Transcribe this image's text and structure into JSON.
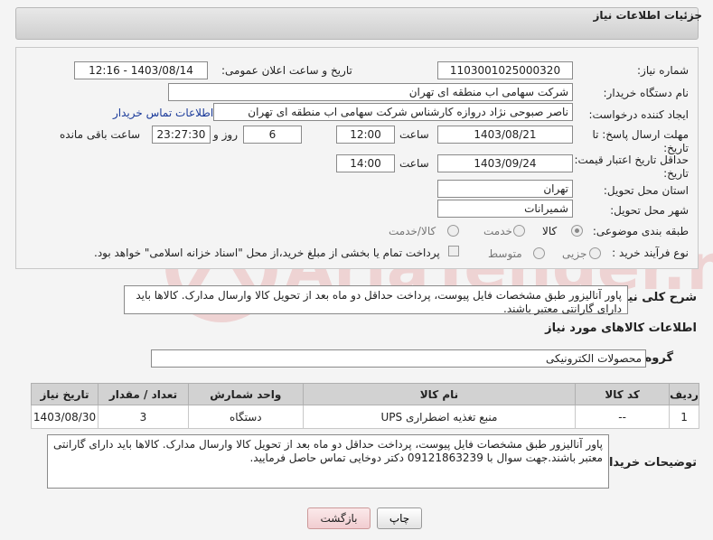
{
  "panel": {
    "title": "جزئیات اطلاعات نیاز"
  },
  "form": {
    "need_number_label": "شماره نیاز:",
    "need_number": "1103001025000320",
    "announce_label": "تاریخ و ساعت اعلان عمومی:",
    "announce_value": "1403/08/14 - 12:16",
    "buyer_org_label": "نام دستگاه خریدار:",
    "buyer_org": "شرکت سهامی اب منطقه ای تهران",
    "creator_label": "ایجاد کننده درخواست:",
    "creator": "ناصر صبوحی نژاد دروازه کارشناس شرکت سهامی اب منطقه ای تهران",
    "contact_link": "اطلاعات تماس خریدار",
    "reply_deadline_label_1": "مهلت ارسال پاسخ: تا",
    "reply_deadline_label_2": "تاریخ:",
    "reply_date": "1403/08/21",
    "time_label": "ساعت",
    "reply_time": "12:00",
    "days_value": "6",
    "days_label": "روز و",
    "remaining_time": "23:27:30",
    "remaining_label": "ساعت باقی مانده",
    "price_validity_label_1": "حداقل تاریخ اعتبار قیمت: تا",
    "price_validity_label_2": "تاریخ:",
    "price_date": "1403/09/24",
    "price_time": "14:00",
    "province_label": "استان محل تحویل:",
    "province": "تهران",
    "city_label": "شهر محل تحویل:",
    "city": "شمیرانات",
    "category_label": "طبقه بندی موضوعی:",
    "category_options": [
      "کالا",
      "خدمت",
      "کالا/خدمت"
    ],
    "category_selected": "کالا",
    "process_label": "نوع فرآیند خرید :",
    "process_options": [
      "جزیی",
      "متوسط"
    ],
    "payment_note": "پرداخت تمام یا بخشی از مبلغ خرید،از محل \"اسناد خزانه اسلامی\" خواهد بود."
  },
  "description": {
    "label": "شرح کلی نیاز:",
    "text": "پاور آنالیزور طبق مشخصات فایل پیوست، پرداخت حداقل دو ماه بعد از تحویل کالا وارسال مدارک. کالاها باید دارای گارانتی معتبر باشند."
  },
  "items_section": {
    "title": "اطلاعات کالاهای مورد نیاز",
    "group_label": "گروه کالا:",
    "group_value": "محصولات الکترونیکی",
    "columns": [
      "ردیف",
      "کد کالا",
      "نام کالا",
      "واحد شمارش",
      "تعداد / مقدار",
      "تاریخ نیاز"
    ],
    "rows": [
      {
        "index": "1",
        "code": "--",
        "name": "منبع تغذیه اضطراری UPS",
        "unit": "دستگاه",
        "qty": "3",
        "date": "1403/08/30"
      }
    ]
  },
  "buyer_notes": {
    "label": "توضیحات خریدار:",
    "text": "پاور آنالیزور طبق مشخصات فایل پیوست، پرداخت حداقل دو ماه بعد از تحویل کالا وارسال مدارک. کالاها باید دارای گارانتی معتبر باشند.جهت سوال با 09121863239 دکتر دوخایی تماس حاصل فرمایید."
  },
  "buttons": {
    "print": "چاپ",
    "back": "بازگشت"
  },
  "watermark": {
    "text": "AriaTender.neT"
  },
  "colors": {
    "link": "#1a3a9a",
    "header_bg": "#d2d2d2",
    "back_button": "#f1cdd0"
  }
}
